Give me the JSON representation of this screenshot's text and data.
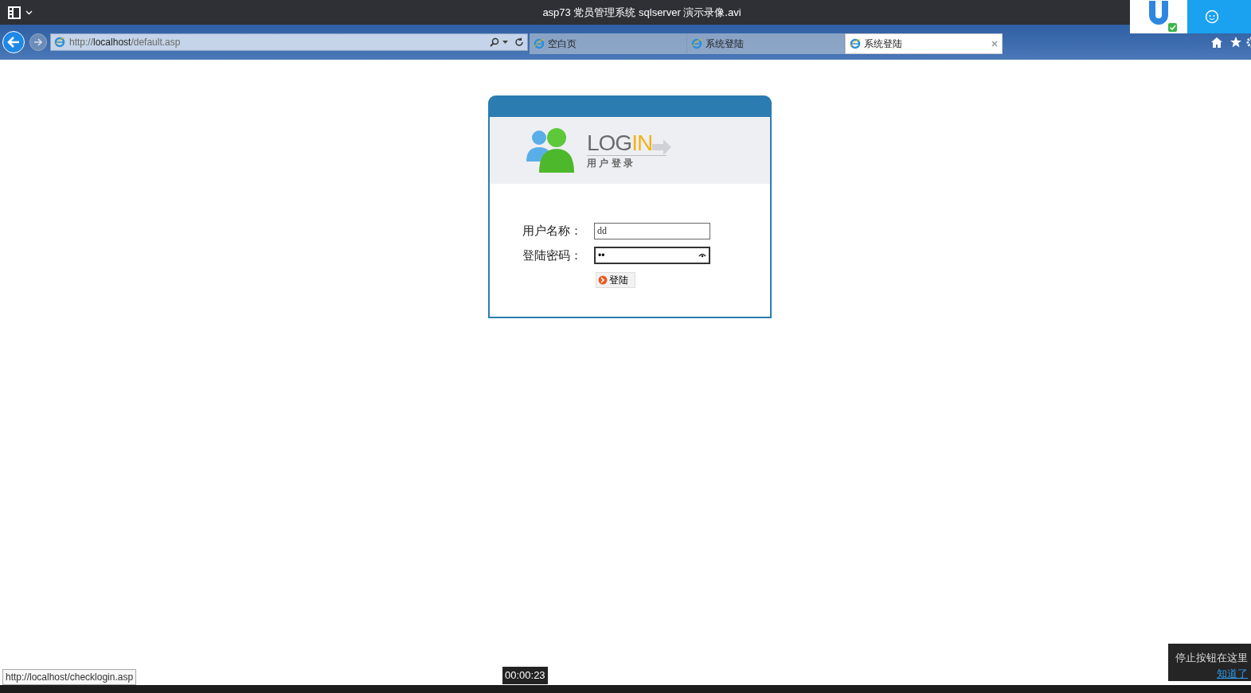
{
  "player": {
    "title": "asp73 党员管理系统 sqlserver 演示录像.avi",
    "tooltip_time": "00:00:23",
    "hint": {
      "text": "停止按钮在这里",
      "link": "知道了"
    }
  },
  "browser": {
    "address": [
      {
        "text": "http://",
        "kind": "dim"
      },
      {
        "text": "localhost",
        "kind": "host"
      },
      {
        "text": "/default.asp",
        "kind": "dim"
      }
    ],
    "tabs": [
      {
        "label": "空白页",
        "selected": false
      },
      {
        "label": "系统登陆",
        "selected": false
      },
      {
        "label": "系统登陆",
        "selected": true
      }
    ],
    "status_url": "http://localhost/checklogin.asp"
  },
  "login": {
    "logo": [
      {
        "text": "LOG",
        "kind": "plain"
      },
      {
        "text": "IN",
        "kind": "accent"
      }
    ],
    "logo_sub": "用 户 登 录",
    "fields": [
      {
        "label": "用户名称：",
        "value": "dd",
        "kind": "text"
      },
      {
        "label": "登陆密码：",
        "value": "••",
        "kind": "password"
      }
    ],
    "button": "登陆"
  }
}
